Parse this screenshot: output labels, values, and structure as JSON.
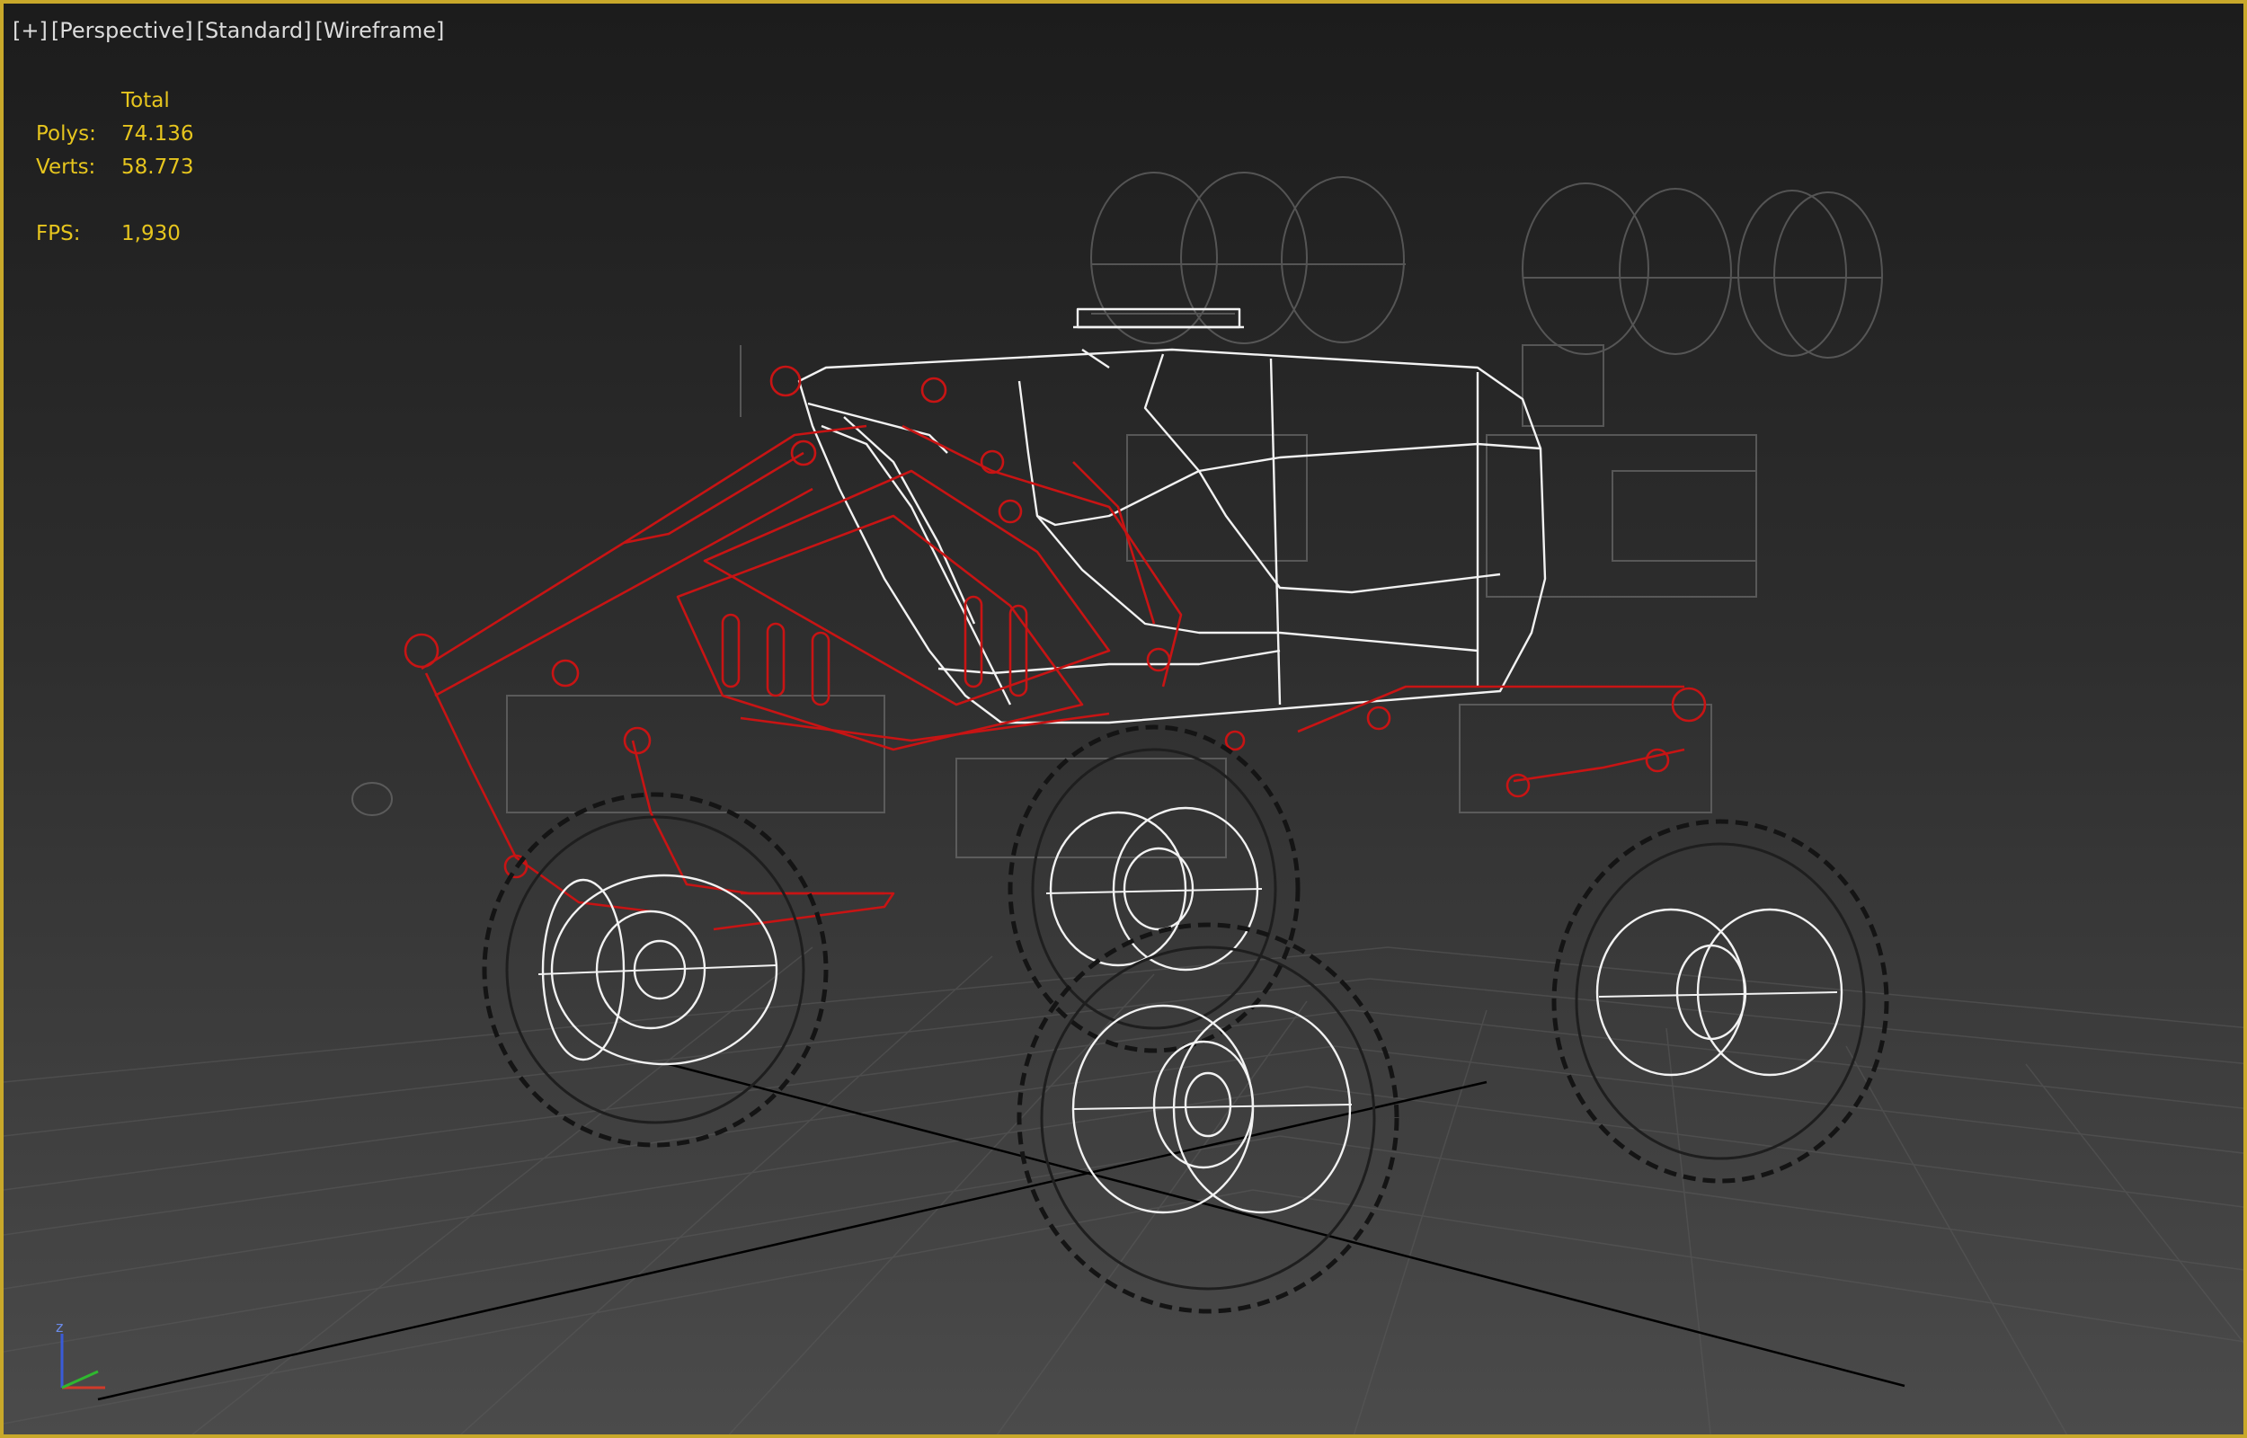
{
  "viewport": {
    "labels": [
      "[+]",
      "[Perspective]",
      "[Standard]",
      "[Wireframe]"
    ]
  },
  "stats": {
    "header": "Total",
    "polys_label": "Polys:",
    "polys_value": "74.136",
    "verts_label": "Verts:",
    "verts_value": "58.773",
    "fps_label": "FPS:",
    "fps_value": "1,930"
  },
  "gizmo": {
    "z_label": "z"
  },
  "colors": {
    "border": "#c8a82a",
    "stats_text": "#e6c51e",
    "selected_wire": "#c81414",
    "wire": "#ffffff",
    "tire_wire": "#141414",
    "grid": "#5a5a5a"
  },
  "icons": {
    "axis_gizmo": "xyz-axis-tripod-icon"
  }
}
